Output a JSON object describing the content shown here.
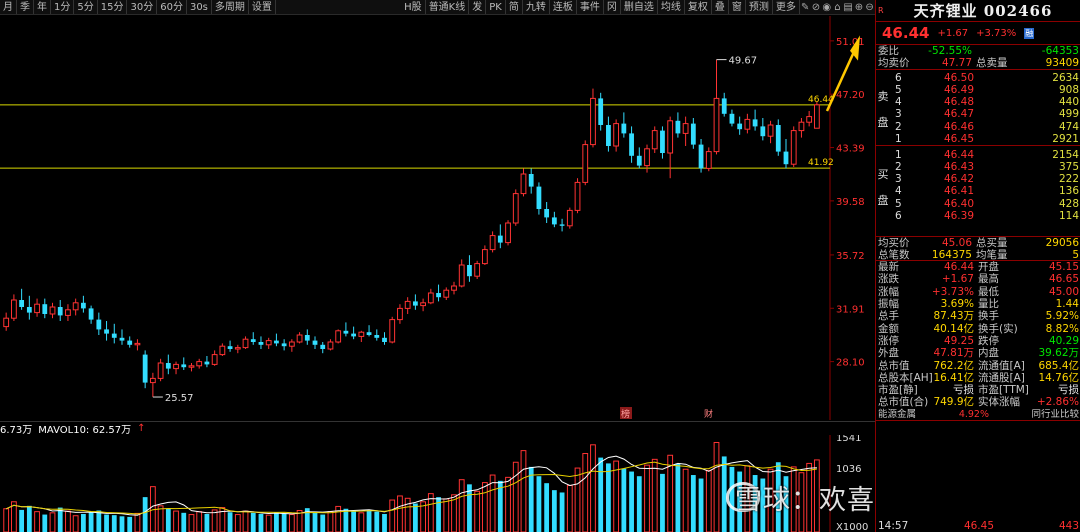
{
  "toolbar": {
    "periods": [
      "月",
      "季",
      "年",
      "1分",
      "5分",
      "15分",
      "30分",
      "60分",
      "30s",
      "多周期",
      "设置"
    ],
    "mid": [
      "H股",
      "普通K线"
    ],
    "right": [
      "发",
      "PK",
      "简",
      "九转",
      "连板",
      "事件",
      "冈",
      "删自选",
      "均线",
      "复权",
      "叠",
      "窗",
      "预测",
      "更多"
    ]
  },
  "chart": {
    "price_labels": [
      "51.01",
      "47.20",
      "43.39",
      "39.58",
      "35.72",
      "31.91",
      "28.10"
    ],
    "hline_upper": "46.44",
    "hline_lower": "41.92",
    "high_marker": "49.67",
    "low_marker": "25.57",
    "event_markers": [
      "榜",
      "财"
    ]
  },
  "volume": {
    "vol_label": "6.73万",
    "mavol_label": "MAVOL10: 62.57万",
    "axis_labels": [
      "1541",
      "1036",
      "X1000"
    ]
  },
  "chart_data": {
    "type": "candlestick",
    "ylim": [
      24.5,
      52.5
    ],
    "candles": [
      [
        30.6,
        31.6,
        30.3,
        31.2
      ],
      [
        31.2,
        32.9,
        31.0,
        32.5
      ],
      [
        32.5,
        33.3,
        31.8,
        32.0
      ],
      [
        32.0,
        32.8,
        31.1,
        31.6
      ],
      [
        31.6,
        32.6,
        31.3,
        32.2
      ],
      [
        32.2,
        32.6,
        31.2,
        31.5
      ],
      [
        31.5,
        32.3,
        31.2,
        32.0
      ],
      [
        32.0,
        32.5,
        31.0,
        31.4
      ],
      [
        31.4,
        32.2,
        31.0,
        31.8
      ],
      [
        31.8,
        32.6,
        31.4,
        32.3
      ],
      [
        32.3,
        32.8,
        31.6,
        31.9
      ],
      [
        31.9,
        32.1,
        30.8,
        31.1
      ],
      [
        31.1,
        31.6,
        30.0,
        30.4
      ],
      [
        30.4,
        31.0,
        29.6,
        30.1
      ],
      [
        30.1,
        30.8,
        29.4,
        29.8
      ],
      [
        29.8,
        30.4,
        29.3,
        29.6
      ],
      [
        29.6,
        29.9,
        29.1,
        29.3
      ],
      [
        29.3,
        29.7,
        28.9,
        29.4
      ],
      [
        28.6,
        28.9,
        26.2,
        26.6
      ],
      [
        26.6,
        27.3,
        25.57,
        26.9
      ],
      [
        26.9,
        28.3,
        26.7,
        28.0
      ],
      [
        28.0,
        28.6,
        27.2,
        27.6
      ],
      [
        27.6,
        28.1,
        27.2,
        27.9
      ],
      [
        27.9,
        28.4,
        27.5,
        27.7
      ],
      [
        27.7,
        28.0,
        27.4,
        27.8
      ],
      [
        27.8,
        28.3,
        27.6,
        28.1
      ],
      [
        28.1,
        28.5,
        27.7,
        27.9
      ],
      [
        27.9,
        28.9,
        27.8,
        28.6
      ],
      [
        28.6,
        29.4,
        28.5,
        29.2
      ],
      [
        29.2,
        29.6,
        28.8,
        29.0
      ],
      [
        29.0,
        29.3,
        28.7,
        29.1
      ],
      [
        29.1,
        29.9,
        29.0,
        29.7
      ],
      [
        29.7,
        30.2,
        29.3,
        29.5
      ],
      [
        29.5,
        29.9,
        29.0,
        29.3
      ],
      [
        29.3,
        29.8,
        29.0,
        29.6
      ],
      [
        29.6,
        30.1,
        29.2,
        29.4
      ],
      [
        29.4,
        29.7,
        28.9,
        29.2
      ],
      [
        29.2,
        29.7,
        28.8,
        29.5
      ],
      [
        29.5,
        30.2,
        29.4,
        30.0
      ],
      [
        30.0,
        30.4,
        29.3,
        29.6
      ],
      [
        29.6,
        29.9,
        29.0,
        29.3
      ],
      [
        29.3,
        29.5,
        28.7,
        29.0
      ],
      [
        29.0,
        29.7,
        28.9,
        29.5
      ],
      [
        29.5,
        30.4,
        29.4,
        30.3
      ],
      [
        30.3,
        30.9,
        29.9,
        30.1
      ],
      [
        30.1,
        30.6,
        29.7,
        29.9
      ],
      [
        29.9,
        30.3,
        29.5,
        30.2
      ],
      [
        30.2,
        30.7,
        29.9,
        30.0
      ],
      [
        30.0,
        30.4,
        29.6,
        29.8
      ],
      [
        29.8,
        30.2,
        29.3,
        29.5
      ],
      [
        29.5,
        31.3,
        29.4,
        31.1
      ],
      [
        31.1,
        32.2,
        30.8,
        31.9
      ],
      [
        31.9,
        32.7,
        31.5,
        32.4
      ],
      [
        32.4,
        32.9,
        31.8,
        32.1
      ],
      [
        32.1,
        32.6,
        31.7,
        32.3
      ],
      [
        32.3,
        33.3,
        32.2,
        33.0
      ],
      [
        33.0,
        33.6,
        32.4,
        32.7
      ],
      [
        32.7,
        33.4,
        32.5,
        33.2
      ],
      [
        33.2,
        33.8,
        32.9,
        33.5
      ],
      [
        33.5,
        35.4,
        33.4,
        35.0
      ],
      [
        35.0,
        35.7,
        33.8,
        34.2
      ],
      [
        34.2,
        35.3,
        34.0,
        35.1
      ],
      [
        35.1,
        36.4,
        35.0,
        36.1
      ],
      [
        36.1,
        37.4,
        35.9,
        37.1
      ],
      [
        37.1,
        37.9,
        36.2,
        36.6
      ],
      [
        36.6,
        38.2,
        36.4,
        38.0
      ],
      [
        38.0,
        40.4,
        37.8,
        40.1
      ],
      [
        40.1,
        41.9,
        39.9,
        41.5
      ],
      [
        41.5,
        41.9,
        40.1,
        40.6
      ],
      [
        40.6,
        40.9,
        38.6,
        39.0
      ],
      [
        39.0,
        39.5,
        38.0,
        38.4
      ],
      [
        38.4,
        38.8,
        37.7,
        37.9
      ],
      [
        37.9,
        38.3,
        37.4,
        37.8
      ],
      [
        37.8,
        39.1,
        37.6,
        38.9
      ],
      [
        38.9,
        41.2,
        38.7,
        40.9
      ],
      [
        40.9,
        43.9,
        40.7,
        43.6
      ],
      [
        43.6,
        47.6,
        43.4,
        46.9
      ],
      [
        46.9,
        47.3,
        44.6,
        45.0
      ],
      [
        45.0,
        45.6,
        43.1,
        43.5
      ],
      [
        43.5,
        45.4,
        43.1,
        45.1
      ],
      [
        45.1,
        45.9,
        44.1,
        44.4
      ],
      [
        44.4,
        44.9,
        42.3,
        42.8
      ],
      [
        42.8,
        43.4,
        41.9,
        42.1
      ],
      [
        42.1,
        43.6,
        41.6,
        43.3
      ],
      [
        43.3,
        44.9,
        43.0,
        44.6
      ],
      [
        44.6,
        44.9,
        42.6,
        43.0
      ],
      [
        43.0,
        45.6,
        41.2,
        45.3
      ],
      [
        45.3,
        45.9,
        44.1,
        44.4
      ],
      [
        44.4,
        45.6,
        43.5,
        45.1
      ],
      [
        45.1,
        45.5,
        43.3,
        43.6
      ],
      [
        43.6,
        44.0,
        41.6,
        41.9
      ],
      [
        41.9,
        43.4,
        41.7,
        43.1
      ],
      [
        43.1,
        49.67,
        42.9,
        46.9
      ],
      [
        46.9,
        47.3,
        45.6,
        45.8
      ],
      [
        45.8,
        46.1,
        44.9,
        45.1
      ],
      [
        45.1,
        45.6,
        44.3,
        44.7
      ],
      [
        44.7,
        45.8,
        44.4,
        45.4
      ],
      [
        45.4,
        46.1,
        44.6,
        44.9
      ],
      [
        44.9,
        45.5,
        43.9,
        44.2
      ],
      [
        44.2,
        45.3,
        43.7,
        45.0
      ],
      [
        45.0,
        45.4,
        42.8,
        43.1
      ],
      [
        43.1,
        44.0,
        41.9,
        42.2
      ],
      [
        42.2,
        44.9,
        42.0,
        44.6
      ],
      [
        44.6,
        45.5,
        44.1,
        45.2
      ],
      [
        45.2,
        46.0,
        44.9,
        45.6
      ],
      [
        44.77,
        46.65,
        45.0,
        46.44
      ]
    ],
    "volumes": [
      40,
      52,
      38,
      45,
      35,
      30,
      33,
      42,
      36,
      28,
      31,
      34,
      37,
      30,
      29,
      27,
      26,
      32,
      60,
      78,
      45,
      40,
      36,
      33,
      30,
      35,
      31,
      38,
      42,
      34,
      30,
      36,
      33,
      31,
      29,
      34,
      32,
      30,
      37,
      41,
      33,
      30,
      35,
      44,
      40,
      36,
      33,
      38,
      35,
      31,
      55,
      62,
      58,
      49,
      52,
      66,
      60,
      57,
      64,
      90,
      82,
      70,
      85,
      98,
      88,
      94,
      120,
      140,
      112,
      96,
      84,
      72,
      68,
      80,
      110,
      135,
      150,
      128,
      118,
      122,
      109,
      104,
      96,
      115,
      125,
      100,
      132,
      118,
      108,
      98,
      92,
      106,
      154,
      130,
      112,
      104,
      114,
      98,
      92,
      108,
      120,
      96,
      112,
      102,
      118,
      124
    ],
    "ma_price": [],
    "price_axis": [
      "51.01",
      "47.20",
      "43.39",
      "39.58",
      "35.72",
      "31.91",
      "28.10"
    ]
  },
  "panel": {
    "r_tag": "R",
    "name": "天齐锂业 002466",
    "price": "46.44",
    "change": "+1.67",
    "pct": "+3.73%",
    "lock": "融",
    "webi_label": "委比",
    "webi_val": "-52.55%",
    "webi_val2": "-64353",
    "avgsell_label": "均卖价",
    "avgsell_val": "47.77",
    "totalsell_label": "总卖量",
    "totalsell_val": "93409",
    "sell_side": "卖\n\n盘",
    "sells": [
      {
        "n": "6",
        "p": "46.50",
        "q": "2634"
      },
      {
        "n": "5",
        "p": "46.49",
        "q": "908"
      },
      {
        "n": "4",
        "p": "46.48",
        "q": "440"
      },
      {
        "n": "3",
        "p": "46.47",
        "q": "499"
      },
      {
        "n": "2",
        "p": "46.46",
        "q": "474"
      },
      {
        "n": "1",
        "p": "46.45",
        "q": "2921"
      }
    ],
    "buy_side": "买\n\n盘",
    "buys": [
      {
        "n": "1",
        "p": "46.44",
        "q": "2154"
      },
      {
        "n": "2",
        "p": "46.43",
        "q": "375"
      },
      {
        "n": "3",
        "p": "46.42",
        "q": "222"
      },
      {
        "n": "4",
        "p": "46.41",
        "q": "136"
      },
      {
        "n": "5",
        "p": "46.40",
        "q": "428"
      },
      {
        "n": "6",
        "p": "46.39",
        "q": "114"
      }
    ],
    "avgbuy_label": "均买价",
    "avgbuy_val": "45.06",
    "totalbuy_label": "总买量",
    "totalbuy_val": "29056",
    "totaltrades_label": "总笔数",
    "totaltrades_val": "164375",
    "avgtrade_label": "均笔量",
    "avgtrade_val": "5",
    "stats": [
      {
        "l": "最新",
        "v": "46.44",
        "vc": "red",
        "l2": "开盘",
        "v2": "45.15",
        "v2c": "red"
      },
      {
        "l": "涨跌",
        "v": "+1.67",
        "vc": "red",
        "l2": "最高",
        "v2": "46.65",
        "v2c": "red"
      },
      {
        "l": "涨幅",
        "v": "+3.73%",
        "vc": "red",
        "l2": "最低",
        "v2": "45.00",
        "v2c": "red"
      },
      {
        "l": "振幅",
        "v": "3.69%",
        "vc": "yellow",
        "l2": "量比",
        "v2": "1.44",
        "v2c": "yellow"
      },
      {
        "l": "总手",
        "v": "87.43万",
        "vc": "yellow",
        "l2": "换手",
        "v2": "5.92%",
        "v2c": "yellow"
      },
      {
        "l": "金额",
        "v": "40.14亿",
        "vc": "yellow",
        "l2": "换手(实)",
        "v2": "8.82%",
        "v2c": "yellow"
      },
      {
        "l": "涨停",
        "v": "49.25",
        "vc": "red",
        "l2": "跌停",
        "v2": "40.29",
        "v2c": "green"
      },
      {
        "l": "外盘",
        "v": "47.81万",
        "vc": "red",
        "l2": "内盘",
        "v2": "39.62万",
        "v2c": "green"
      },
      {
        "l": "总市值",
        "v": "762.2亿",
        "vc": "yellow",
        "l2": "流通值[A]",
        "v2": "685.4亿",
        "v2c": "yellow"
      },
      {
        "l": "总股本[AH]",
        "v": "16.41亿",
        "vc": "yellow",
        "l2": "流通股[A]",
        "v2": "14.76亿",
        "v2c": "yellow"
      },
      {
        "l": "市盈[静]",
        "v": "亏损",
        "vc": "white",
        "l2": "市盈[TTM]",
        "v2": "亏损",
        "v2c": "white"
      },
      {
        "l": "总市值(合)",
        "v": "749.9亿",
        "vc": "yellow",
        "l2": "实体涨幅",
        "v2": "+2.86%",
        "v2c": "red"
      }
    ],
    "sector_label": "能源金属",
    "sector_pct": "4.92%",
    "peer_label": "同行业比较",
    "ticks": [
      {
        "t": "14:57",
        "p": "46.45",
        "q": "443"
      }
    ]
  },
  "watermark": "雪球：欢喜趋势牛"
}
